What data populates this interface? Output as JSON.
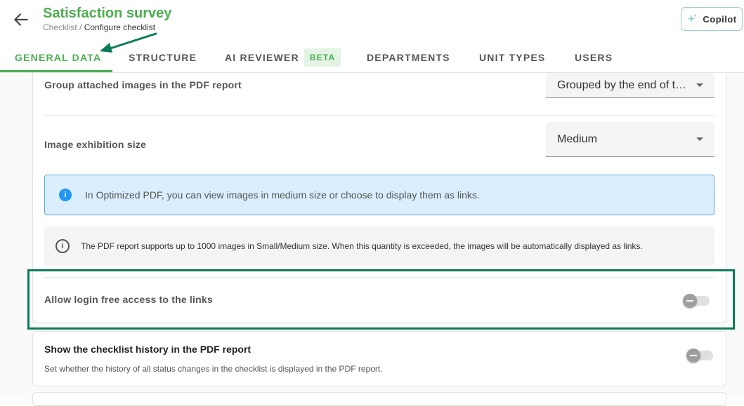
{
  "header": {
    "title": "Satisfaction survey",
    "breadcrumb": {
      "parent": "Checklist",
      "separator": "/",
      "current": "Configure checklist"
    },
    "copilot_label": "Copilot"
  },
  "tabs": [
    {
      "label": "GENERAL DATA",
      "active": true
    },
    {
      "label": "STRUCTURE"
    },
    {
      "label": "AI REVIEWER",
      "badge": "BETA"
    },
    {
      "label": "DEPARTMENTS"
    },
    {
      "label": "UNIT TYPES"
    },
    {
      "label": "USERS"
    }
  ],
  "settings": {
    "group_images": {
      "label": "Group attached images in the PDF report",
      "value": "Grouped by the end of the checklist"
    },
    "image_size": {
      "label": "Image exhibition size",
      "value": "Medium"
    },
    "info_message": "In Optimized PDF, you can view images in medium size or choose to display them as links.",
    "note_message": "The PDF report supports up to 1000 images in Small/Medium size. When this quantity is exceeded, the images will be automatically displayed as links.",
    "login_free": {
      "label": "Allow login free access to the links",
      "enabled": false
    },
    "history": {
      "label": "Show the checklist history in the PDF report",
      "description": "Set whether the history of all status changes in the checklist is displayed in the PDF report.",
      "enabled": false
    }
  },
  "colors": {
    "accent": "#4caf50",
    "annotation": "#0a7a58",
    "info_bg": "#dbeefd",
    "info_border": "#5aa9e8"
  }
}
